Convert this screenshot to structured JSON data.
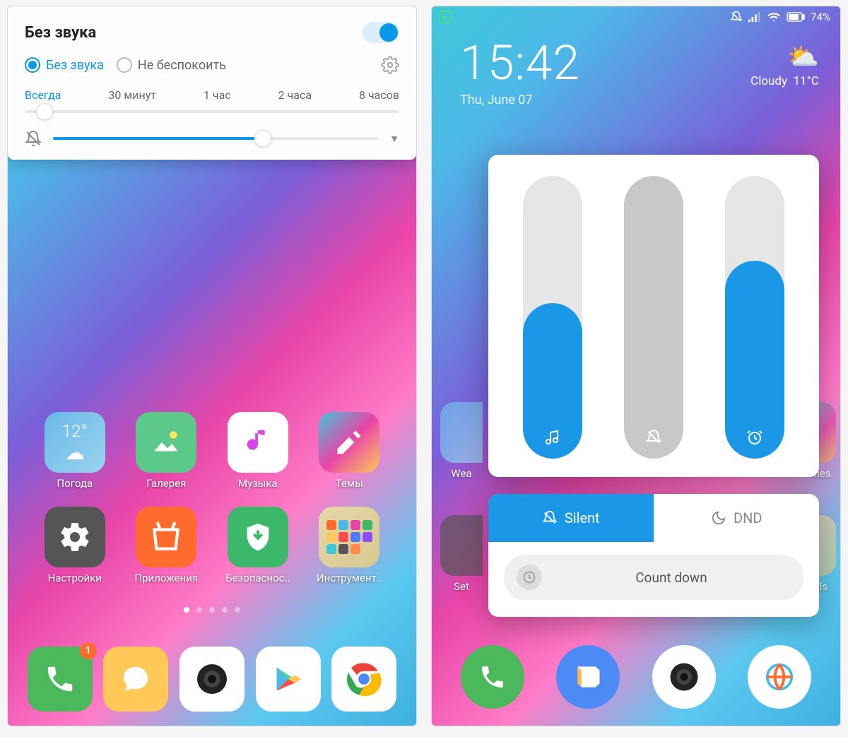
{
  "left": {
    "sound": {
      "title": "Без звука",
      "toggle_on": true,
      "radios": {
        "silent": "Без звука",
        "dnd": "Не беспокоить"
      },
      "durations": [
        "Всегда",
        "30 минут",
        "1 час",
        "2 часа",
        "8 часов"
      ],
      "selected_duration": 0,
      "duration_slider_pct": 3,
      "volume_slider_pct": 62
    },
    "apps_row1": [
      {
        "name": "weather",
        "label": "Погода",
        "temp": "12°"
      },
      {
        "name": "gallery",
        "label": "Галерея"
      },
      {
        "name": "music",
        "label": "Музыка"
      },
      {
        "name": "themes",
        "label": "Темы"
      }
    ],
    "apps_row2": [
      {
        "name": "settings",
        "label": "Настройки"
      },
      {
        "name": "store",
        "label": "Приложения"
      },
      {
        "name": "security",
        "label": "Безопаснос.."
      },
      {
        "name": "tools",
        "label": "Инструмент.."
      }
    ],
    "pages": 5,
    "current_page": 0,
    "dock": [
      {
        "name": "phone",
        "badge": "1"
      },
      {
        "name": "messages"
      },
      {
        "name": "camera"
      },
      {
        "name": "play"
      },
      {
        "name": "chrome"
      }
    ]
  },
  "right": {
    "status": {
      "battery": "74%"
    },
    "clock": {
      "time": "15:42",
      "date": "Thu, June 07"
    },
    "weather": {
      "desc": "Cloudy",
      "temp": "11°C"
    },
    "volumes": {
      "media_pct": 55,
      "ring_pct": 0,
      "alarm_pct": 70
    },
    "modes": {
      "silent": "Silent",
      "dnd": "DND"
    },
    "countdown": "Count down",
    "bg_apps": [
      {
        "label": "Wea"
      },
      {
        "label": ""
      },
      {
        "label": ""
      },
      {
        "label": "mes"
      },
      {
        "label": "Set"
      },
      {
        "label": ""
      },
      {
        "label": ""
      },
      {
        "label": "ols"
      }
    ]
  }
}
